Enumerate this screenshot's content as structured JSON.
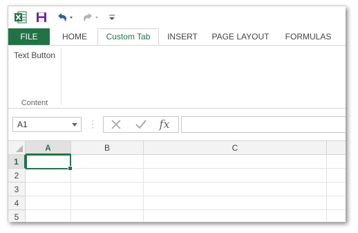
{
  "tabs": {
    "file": "FILE",
    "home": "HOME",
    "custom": "Custom Tab",
    "insert": "INSERT",
    "page_layout": "PAGE LAYOUT",
    "formulas": "FORMULAS"
  },
  "ribbon": {
    "text_button": "Text Button",
    "group_label": "Content"
  },
  "formula_bar": {
    "name_box": "A1",
    "fx": "fx",
    "formula": ""
  },
  "grid": {
    "columns": [
      "A",
      "B",
      "C"
    ],
    "rows": [
      "1",
      "2",
      "3",
      "4",
      "5"
    ],
    "selected_cell": "A1"
  },
  "colors": {
    "accent": "#217346",
    "header_bg": "#f3f3f3",
    "active_header_bg": "#e1e1e1",
    "gridline": "#e3e3e3"
  }
}
